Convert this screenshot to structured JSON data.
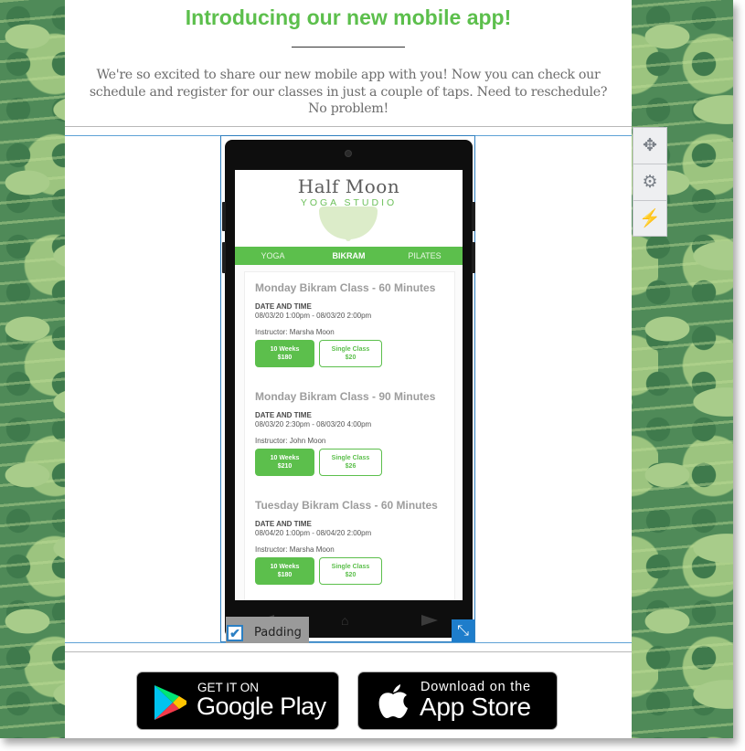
{
  "header": {
    "title": "Introducing our new mobile app!",
    "intro": "We're so excited to share our new mobile app with you! Now you can check our schedule and register for our classes in just a couple of taps. Need to reschedule? No problem!"
  },
  "colors": {
    "accent_green": "#5cbf4c",
    "selection_blue": "#2f7fc0"
  },
  "phone": {
    "logo": {
      "name": "Half Moon",
      "subtitle": "YOGA STUDIO"
    },
    "nav": [
      {
        "label": "YOGA",
        "active": false
      },
      {
        "label": "BIKRAM",
        "active": true
      },
      {
        "label": "PILATES",
        "active": false
      }
    ],
    "classes": [
      {
        "title": "Monday Bikram Class - 60 Minutes",
        "date_label": "DATE AND TIME",
        "date": "08/03/20 1:00pm - 08/03/20 2:00pm",
        "instructor": "Instructor: Marsha Moon",
        "options": [
          {
            "line1": "10 Weeks",
            "line2": "$180"
          },
          {
            "line1": "Single Class",
            "line2": "$20"
          }
        ]
      },
      {
        "title": "Monday Bikram Class - 90 Minutes",
        "date_label": "DATE AND TIME",
        "date": "08/03/20 2:30pm - 08/03/20 4:00pm",
        "instructor": "Instructor: John Moon",
        "options": [
          {
            "line1": "10 Weeks",
            "line2": "$210"
          },
          {
            "line1": "Single Class",
            "line2": "$26"
          }
        ]
      },
      {
        "title": "Tuesday Bikram Class - 60 Minutes",
        "date_label": "DATE AND TIME",
        "date": "08/04/20 1:00pm - 08/04/20 2:00pm",
        "instructor": "Instructor: Marsha Moon",
        "options": [
          {
            "line1": "10 Weeks",
            "line2": "$180"
          },
          {
            "line1": "Single Class",
            "line2": "$20"
          }
        ]
      }
    ]
  },
  "editor": {
    "padding_label": "Padding",
    "padding_checked": true,
    "tools": [
      {
        "icon": "move-icon",
        "glyph": "✥"
      },
      {
        "icon": "gear-icon",
        "glyph": "⚙"
      },
      {
        "icon": "lightning-icon",
        "glyph": "⚡"
      }
    ],
    "resize_glyph": "⤡"
  },
  "stores": {
    "google": {
      "small": "GET IT ON",
      "big": "Google Play"
    },
    "apple": {
      "small": "Download on the",
      "big": "App Store"
    }
  }
}
